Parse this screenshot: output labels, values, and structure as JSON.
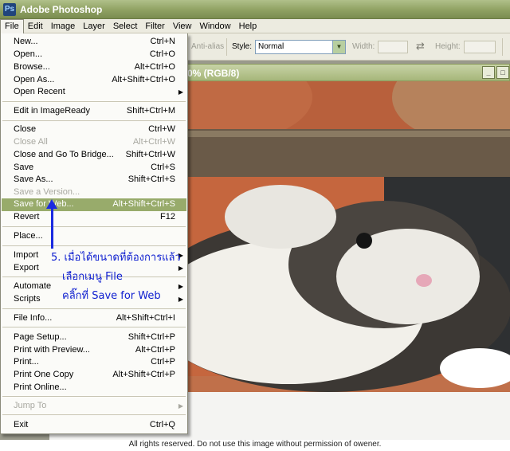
{
  "app": {
    "title": "Adobe Photoshop",
    "icon": "photoshop-icon"
  },
  "menubar": [
    "File",
    "Edit",
    "Image",
    "Layer",
    "Select",
    "Filter",
    "View",
    "Window",
    "Help"
  ],
  "options": {
    "anti_alias": "Anti-alias",
    "style_label": "Style:",
    "style_value": "Normal",
    "width_label": "Width:",
    "height_label": "Height:"
  },
  "document": {
    "title_fragment": "0% (RGB/8)"
  },
  "file_menu": [
    {
      "label": "New...",
      "shortcut": "Ctrl+N"
    },
    {
      "label": "Open...",
      "shortcut": "Ctrl+O"
    },
    {
      "label": "Browse...",
      "shortcut": "Alt+Ctrl+O"
    },
    {
      "label": "Open As...",
      "shortcut": "Alt+Shift+Ctrl+O"
    },
    {
      "label": "Open Recent",
      "shortcut": ""
    },
    {
      "label": "Edit in ImageReady",
      "shortcut": "Shift+Ctrl+M"
    },
    {
      "label": "Close",
      "shortcut": "Ctrl+W"
    },
    {
      "label": "Close All",
      "shortcut": "Alt+Ctrl+W"
    },
    {
      "label": "Close and Go To Bridge...",
      "shortcut": "Shift+Ctrl+W"
    },
    {
      "label": "Save",
      "shortcut": "Ctrl+S"
    },
    {
      "label": "Save As...",
      "shortcut": "Shift+Ctrl+S"
    },
    {
      "label": "Save a Version...",
      "shortcut": ""
    },
    {
      "label": "Save for Web...",
      "shortcut": "Alt+Shift+Ctrl+S"
    },
    {
      "label": "Revert",
      "shortcut": "F12"
    },
    {
      "label": "Place...",
      "shortcut": ""
    },
    {
      "label": "Import",
      "shortcut": ""
    },
    {
      "label": "Export",
      "shortcut": ""
    },
    {
      "label": "Automate",
      "shortcut": ""
    },
    {
      "label": "Scripts",
      "shortcut": ""
    },
    {
      "label": "File Info...",
      "shortcut": "Alt+Shift+Ctrl+I"
    },
    {
      "label": "Page Setup...",
      "shortcut": "Shift+Ctrl+P"
    },
    {
      "label": "Print with Preview...",
      "shortcut": "Alt+Ctrl+P"
    },
    {
      "label": "Print...",
      "shortcut": "Ctrl+P"
    },
    {
      "label": "Print One Copy",
      "shortcut": "Alt+Shift+Ctrl+P"
    },
    {
      "label": "Print Online...",
      "shortcut": ""
    },
    {
      "label": "Jump To",
      "shortcut": ""
    },
    {
      "label": "Exit",
      "shortcut": "Ctrl+Q"
    }
  ],
  "annotation": {
    "line1": "5. เมื่อได้ขนาดที่ต้องการแล้ว",
    "line2": "เลือกเมนู File",
    "line3": "คลิ๊กที่ Save for Web"
  },
  "footer": "All rights reserved. Do not use this image without permission of owener."
}
